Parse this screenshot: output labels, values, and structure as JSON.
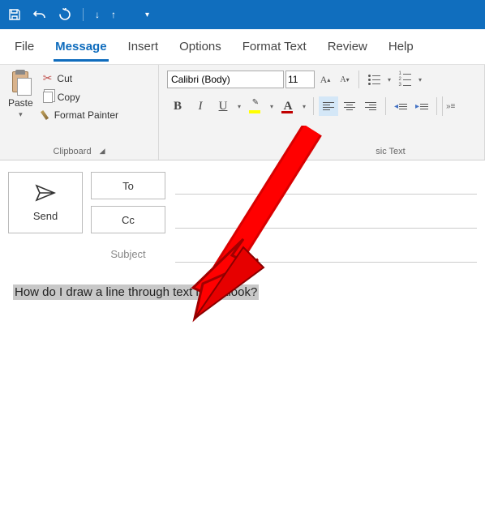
{
  "titlebar": {
    "save": "save-icon",
    "undo": "undo-icon",
    "redo": "redo-icon"
  },
  "tabs": {
    "file": "File",
    "message": "Message",
    "insert": "Insert",
    "options": "Options",
    "format_text": "Format Text",
    "review": "Review",
    "help": "Help"
  },
  "ribbon": {
    "clipboard": {
      "paste": "Paste",
      "cut": "Cut",
      "copy": "Copy",
      "format_painter": "Format Painter",
      "group_label": "Clipboard"
    },
    "font": {
      "font_name": "Calibri (Body)",
      "font_size": "11",
      "bold": "B",
      "italic": "I",
      "underline": "U",
      "highlight": "A",
      "font_color": "A"
    },
    "basic_text_label": "sic Text"
  },
  "compose": {
    "send": "Send",
    "to": "To",
    "cc": "Cc",
    "subject": "Subject"
  },
  "body": {
    "text": "How do I draw a line through text in Outlook?"
  }
}
